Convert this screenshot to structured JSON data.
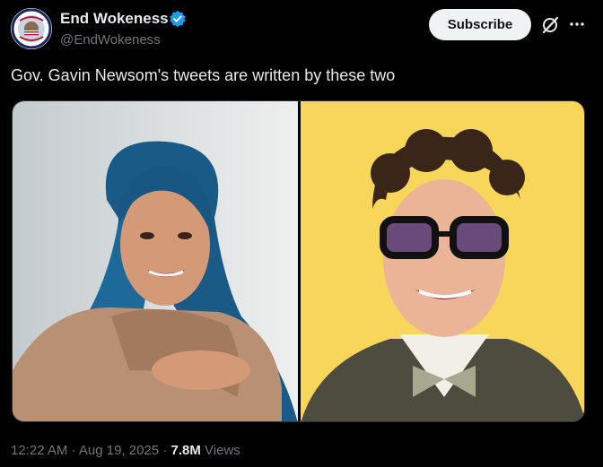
{
  "post": {
    "display_name": "End Wokeness",
    "handle": "@EndWokeness",
    "subscribe_label": "Subscribe",
    "text": "Gov. Gavin Newsom's tweets are written by these two",
    "time": "12:22 AM",
    "separator": "·",
    "date": "Aug 19, 2025",
    "views_count": "7.8M",
    "views_label": "Views"
  },
  "icons": {
    "verified": "verified-badge-icon",
    "grok": "grok-icon",
    "more": "more-dots-icon"
  },
  "colors": {
    "background": "#000000",
    "text_primary": "#e7e9ea",
    "text_secondary": "#71767b",
    "verified_blue": "#1d9bf0",
    "subscribe_bg": "#eff3f4",
    "right_photo_bg": "#f7d65a"
  }
}
